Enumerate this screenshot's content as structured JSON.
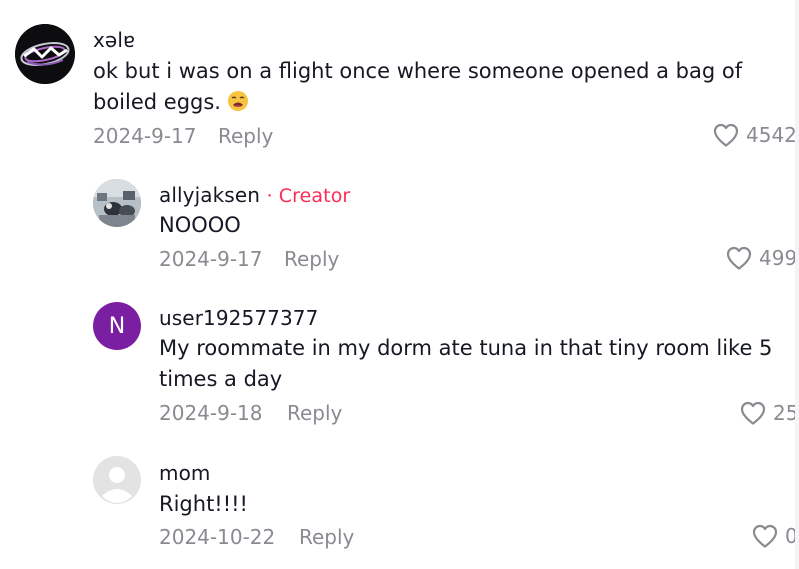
{
  "comments": [
    {
      "username": "xəlɐ",
      "text": "ok but i was on a flight once where someone opened a bag of boiled eggs.",
      "date": "2024-9-17",
      "reply_label": "Reply",
      "likes": "4542"
    },
    {
      "username": "allyjaksen",
      "creator_label": "· Creator",
      "text": "NOOOO",
      "date": "2024-9-17",
      "reply_label": "Reply",
      "likes": "499"
    },
    {
      "username": "user192577377",
      "avatar_letter": "N",
      "text": "My roommate in my dorm ate tuna in that tiny room like 5 times a day",
      "date": "2024-9-18",
      "reply_label": "Reply",
      "likes": "25"
    },
    {
      "username": "mom",
      "text": "Right!!!!",
      "date": "2024-10-22",
      "reply_label": "Reply",
      "likes": "0"
    }
  ],
  "icons": {
    "like": "heart-outline-icon",
    "emoji": "weary-face-emoji"
  },
  "colors": {
    "creator": "#fe2c55",
    "meta": "#8a8b91",
    "avatar_n": "#7b1fa2"
  }
}
